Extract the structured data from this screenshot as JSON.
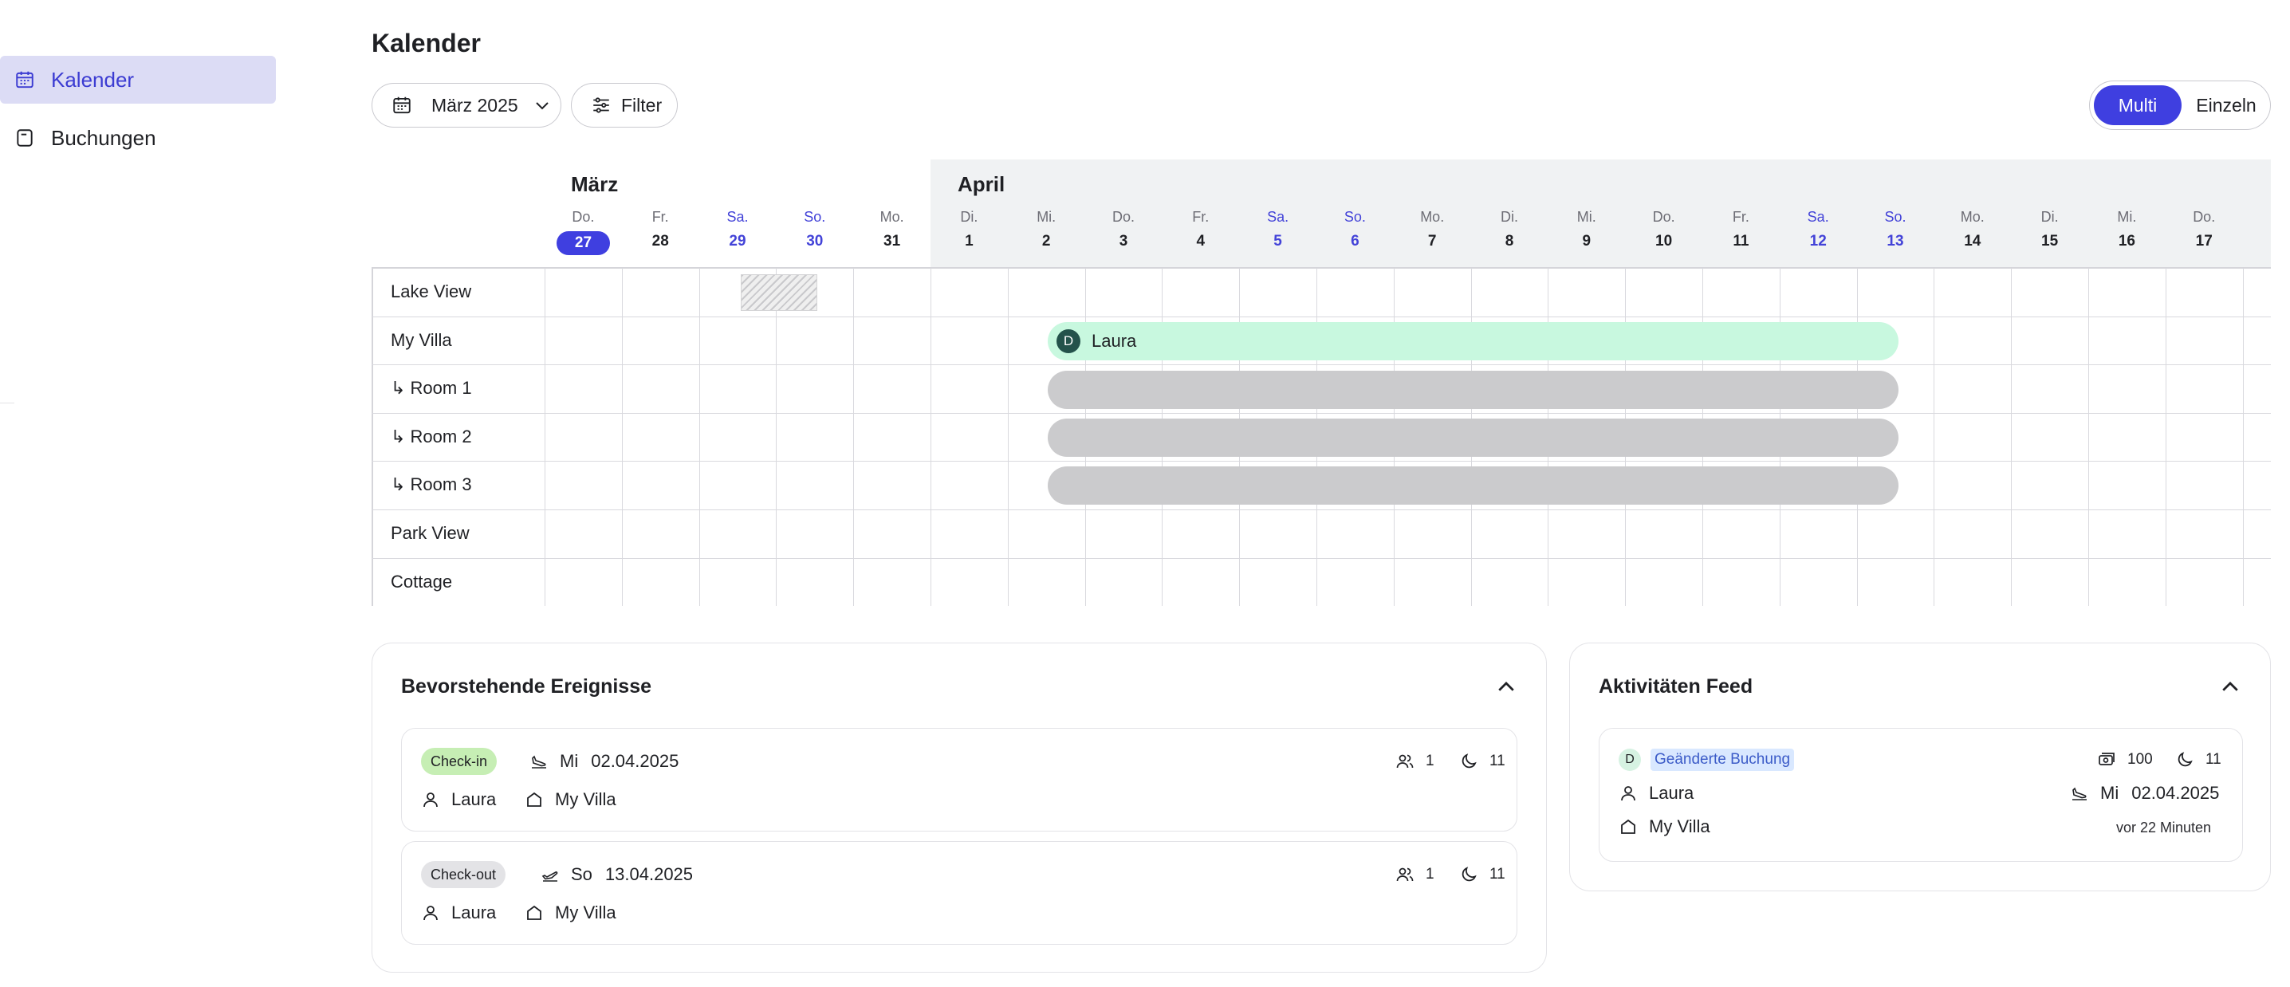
{
  "sidebar": {
    "items": [
      {
        "label": "Kalender",
        "icon": "calendar-icon",
        "active": true
      },
      {
        "label": "Buchungen",
        "icon": "bookings-icon",
        "active": false
      }
    ]
  },
  "header": {
    "title": "Kalender",
    "month_select": "März 2025",
    "filter_label": "Filter",
    "view_toggle": {
      "multi": "Multi",
      "single": "Einzeln",
      "selected": "Multi"
    }
  },
  "calendar": {
    "months": [
      "März",
      "April"
    ],
    "days": [
      {
        "name": "Do.",
        "num": "27"
      },
      {
        "name": "Fr.",
        "num": "28"
      },
      {
        "name": "Sa.",
        "num": "29"
      },
      {
        "name": "So.",
        "num": "30"
      },
      {
        "name": "Mo.",
        "num": "31"
      },
      {
        "name": "Di.",
        "num": "1"
      },
      {
        "name": "Mi.",
        "num": "2"
      },
      {
        "name": "Do.",
        "num": "3"
      },
      {
        "name": "Fr.",
        "num": "4"
      },
      {
        "name": "Sa.",
        "num": "5"
      },
      {
        "name": "So.",
        "num": "6"
      },
      {
        "name": "Mo.",
        "num": "7"
      },
      {
        "name": "Di.",
        "num": "8"
      },
      {
        "name": "Mi.",
        "num": "9"
      },
      {
        "name": "Do.",
        "num": "10"
      },
      {
        "name": "Fr.",
        "num": "11"
      },
      {
        "name": "Sa.",
        "num": "12"
      },
      {
        "name": "So.",
        "num": "13"
      },
      {
        "name": "Mo.",
        "num": "14"
      },
      {
        "name": "Di.",
        "num": "15"
      },
      {
        "name": "Mi.",
        "num": "16"
      },
      {
        "name": "Do.",
        "num": "17"
      }
    ],
    "rows": [
      "Lake View",
      "My Villa",
      "↳ Room 1",
      "↳ Room 2",
      "↳ Room 3",
      "Park View",
      "Cottage"
    ],
    "booking": {
      "guest": "Laura",
      "initial": "D"
    }
  },
  "events": {
    "title": "Bevorstehende Ereignisse",
    "items": [
      {
        "badge": "Check-in",
        "weekday": "Mi",
        "date": "02.04.2025",
        "guests": "1",
        "nights": "11",
        "guest": "Laura",
        "property": "My Villa"
      },
      {
        "badge": "Check-out",
        "weekday": "So",
        "date": "13.04.2025",
        "guests": "1",
        "nights": "11",
        "guest": "Laura",
        "property": "My Villa"
      }
    ]
  },
  "feed": {
    "title": "Aktivitäten Feed",
    "item": {
      "initial": "D",
      "badge": "Geänderte Buchung",
      "amount": "100",
      "nights": "11",
      "guest": "Laura",
      "weekday": "Mi",
      "date": "02.04.2025",
      "property": "My Villa",
      "time_ago": "vor 22 Minuten"
    }
  }
}
